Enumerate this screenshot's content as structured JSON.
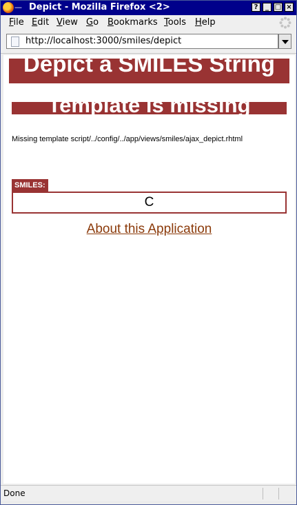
{
  "window": {
    "dash": "—",
    "title": "Depict - Mozilla Firefox <2>",
    "buttons": {
      "help": "?",
      "minimize": "_",
      "maximize": "□",
      "close": "×"
    }
  },
  "menu": {
    "items": [
      {
        "accel": "F",
        "rest": "ile"
      },
      {
        "accel": "E",
        "rest": "dit"
      },
      {
        "accel": "V",
        "rest": "iew"
      },
      {
        "accel": "G",
        "rest": "o"
      },
      {
        "accel": "B",
        "rest": "ookmarks"
      },
      {
        "accel": "T",
        "rest": "ools"
      },
      {
        "accel": "H",
        "rest": "elp"
      }
    ]
  },
  "navigation": {
    "url": "http://localhost:3000/smiles/depict"
  },
  "page": {
    "heading": "Depict a SMILES String",
    "error_heading": "Template is missing",
    "error_message": "Missing template script/../config/../app/views/smiles/ajax_depict.rhtml",
    "form_label": "SMILES:",
    "smiles_value": "C",
    "about_link": "About this Application"
  },
  "status": {
    "text": "Done"
  },
  "colors": {
    "accent": "#993333",
    "link": "#8b3a0a",
    "titlebar": "#00008b"
  }
}
